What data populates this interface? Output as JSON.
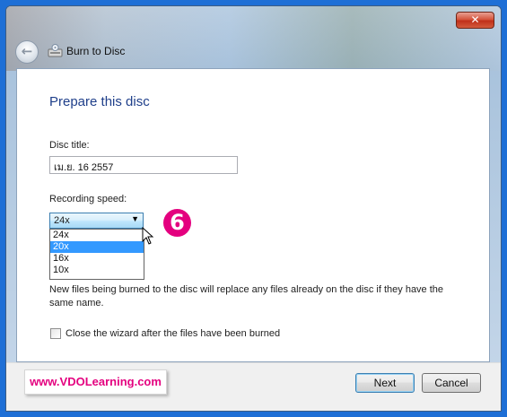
{
  "window": {
    "title": "Burn to Disc",
    "close_label": "✕"
  },
  "page": {
    "heading": "Prepare this disc",
    "disc_title_label": "Disc title:",
    "disc_title_value": "เม.ย. 16 2557",
    "recording_speed_label": "Recording speed:",
    "recording_speed_selected": "24x",
    "speed_options": [
      {
        "label": "24x",
        "highlighted": false
      },
      {
        "label": "20x",
        "highlighted": true
      },
      {
        "label": "16x",
        "highlighted": false
      },
      {
        "label": "10x",
        "highlighted": false
      }
    ],
    "info_text": "New files being burned to the disc will replace any files already on the disc if they have the same name.",
    "close_wizard_label": "Close the wizard after the files have been burned",
    "close_wizard_checked": false
  },
  "annotation": {
    "step_number": "6",
    "watermark": "www.VDOLearning.com"
  },
  "buttons": {
    "next": "Next",
    "cancel": "Cancel"
  },
  "colors": {
    "frame": "#1e6fd6",
    "heading": "#1f3f8a",
    "highlight": "#3399ff",
    "accent_pink": "#e4007f"
  }
}
